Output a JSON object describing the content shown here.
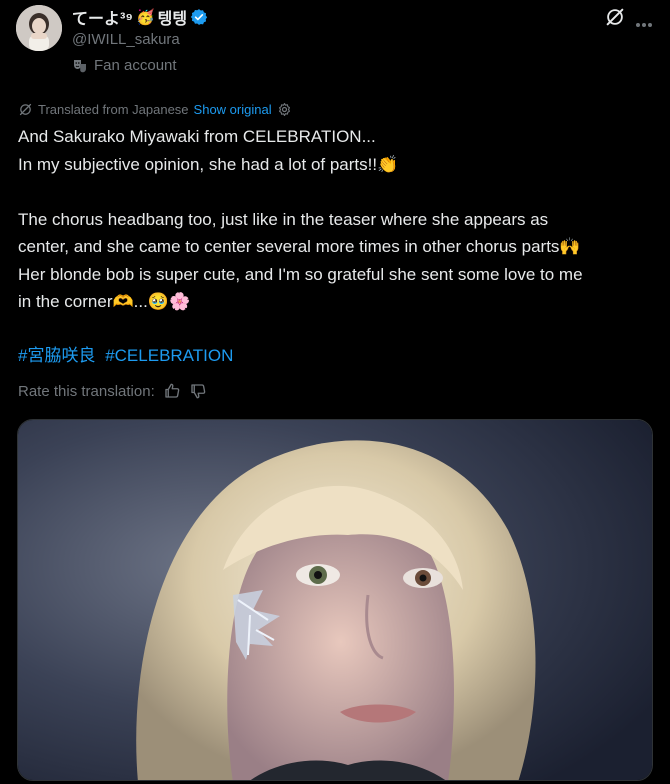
{
  "author": {
    "display_name": "てーよ³⁹",
    "name_emoji_1": "🥳",
    "name_suffix": "텡텡",
    "handle": "@IWILL_sakura",
    "label": "Fan account",
    "avatar_icon": "avatar-photo",
    "verified_icon": "verified-badge-icon"
  },
  "translation": {
    "source_label": "Translated from Japanese",
    "show_original": "Show original"
  },
  "tweet": {
    "line1": "And Sakurako Miyawaki from CELEBRATION...",
    "line2": "In my subjective opinion, she had a lot of parts!!👏",
    "line3": "The chorus headbang too, just like in the teaser where she appears as",
    "line4": "center, and she came to center several more times in other chorus parts🙌",
    "line5": "Her blonde bob is super cute, and I'm so grateful she sent some love to me",
    "line6": "in the corner🫶...🥹🌸",
    "hashtag1": "#宮脇咲良",
    "hashtag2": "#CELEBRATION"
  },
  "rate": {
    "label": "Rate this translation:"
  },
  "media": {
    "alt_subject": "photo"
  },
  "colors": {
    "background": "#000000",
    "text": "#e7e9ea",
    "muted": "#71767b",
    "link": "#1d9bf0",
    "verified": "#1d9bf0"
  }
}
